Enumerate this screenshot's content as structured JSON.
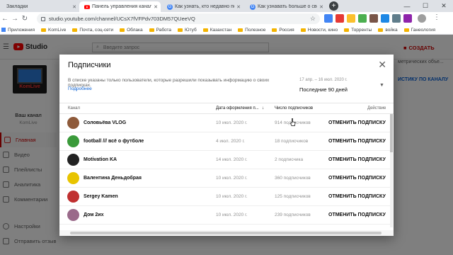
{
  "browser": {
    "tabs": [
      {
        "title": "Закладки"
      },
      {
        "title": "Панель управления каналом -"
      },
      {
        "title": "Как узнать, кто недавно подпис"
      },
      {
        "title": "Как узнавать больше о своей ау"
      }
    ],
    "new_tab": "+",
    "url": "studio.youtube.com/channel/UCsX7fVFPdv703DM57QUeeVQ",
    "bookmarks": [
      "Приложения",
      "KomLive",
      "Почта, соц-сети",
      "Облака",
      "Работа",
      "Ютуб",
      "Казахстан",
      "Полезное",
      "Россия",
      "Новости, кино",
      "Торренты",
      "войка",
      "Ганеология"
    ]
  },
  "youtube": {
    "logo": "Studio",
    "search_placeholder": "Введите запрос",
    "create_label": "СОЗДАТЬ",
    "channel_label": "Ваш канал",
    "channel_name": "KomLive",
    "nav": [
      {
        "label": "Главная"
      },
      {
        "label": "Видео"
      },
      {
        "label": "Плейлисты"
      },
      {
        "label": "Аналитика"
      },
      {
        "label": "Комментарии"
      },
      {
        "label": "Настройки"
      },
      {
        "label": "Отправить отзыв"
      }
    ],
    "right_snippet_1": "метрических объе...",
    "right_snippet_2": "ИСТИКУ ПО КАНАЛУ",
    "avatar_text": "KomLive"
  },
  "modal": {
    "title": "Подписчики",
    "info": "В списке указаны только пользователи, которые разрешили показывать информацию о своих подписках.",
    "more_link": "Подробнее",
    "date_range": "17 апр. – 16 июл. 2020 г.",
    "period": "Последние 90 дней",
    "columns": {
      "channel": "Канал",
      "date": "Дата оформления п...",
      "subs": "Число подписчиков",
      "action": "Действие"
    },
    "rows": [
      {
        "name": "Соловьёва VLOG",
        "date": "10 июл. 2020 г.",
        "subs": "914 подписчиков",
        "action": "ОТМЕНИТЬ ПОДПИСКУ",
        "color": "#8e5a3a"
      },
      {
        "name": "football /// всё о футболе",
        "date": "4 июл. 2020 г.",
        "subs": "18 подписчиков",
        "action": "ОТМЕНИТЬ ПОДПИСКУ",
        "color": "#3a9a3a"
      },
      {
        "name": "Motivation KA",
        "date": "14 июл. 2020 г.",
        "subs": "2 подписчика",
        "action": "ОТМЕНИТЬ ПОДПИСКУ",
        "color": "#222222"
      },
      {
        "name": "Валентина Деньдобрая",
        "date": "10 июл. 2020 г.",
        "subs": "360 подписчиков",
        "action": "ОТМЕНИТЬ ПОДПИСКУ",
        "color": "#e8c400"
      },
      {
        "name": "Sergey Kamen",
        "date": "10 июл. 2020 г.",
        "subs": "125 подписчиков",
        "action": "ОТМЕНИТЬ ПОДПИСКУ",
        "color": "#c03030"
      },
      {
        "name": "Дом 2их",
        "date": "10 июл. 2020 г.",
        "subs": "239 подписчиков",
        "action": "ОТМЕНИТЬ ПОДПИСКУ",
        "color": "#9a6a8a"
      }
    ]
  }
}
